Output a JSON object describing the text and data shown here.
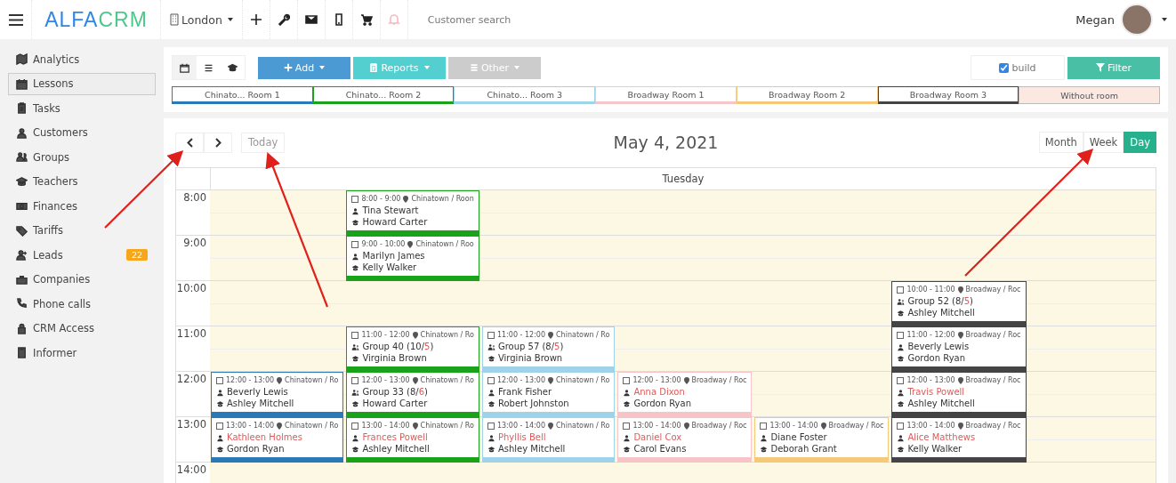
{
  "topbar": {
    "logo": {
      "first": "ALFA",
      "second": "CRM"
    },
    "city": "London",
    "icons": [
      {
        "disabled": false
      },
      {
        "disabled": false
      },
      {
        "disabled": false
      },
      {
        "disabled": false
      },
      {
        "disabled": false
      },
      {
        "disabled": true
      }
    ],
    "search": {
      "placeholder": "Customer search"
    },
    "user": "Megan"
  },
  "sidebar": {
    "items": [
      {
        "label": "Analytics",
        "selected": false
      },
      {
        "label": "Lessons",
        "selected": true
      },
      {
        "label": "Tasks",
        "selected": false
      },
      {
        "label": "Customers",
        "selected": false
      },
      {
        "label": "Groups",
        "selected": false
      },
      {
        "label": "Teachers",
        "selected": false
      },
      {
        "label": "Finances",
        "selected": false
      },
      {
        "label": "Tariffs",
        "selected": false
      },
      {
        "label": "Leads",
        "selected": false,
        "badge": "22"
      },
      {
        "label": "Companies",
        "selected": false
      },
      {
        "label": "Phone calls",
        "selected": false
      },
      {
        "label": "CRM Access",
        "selected": false
      },
      {
        "label": "Informer",
        "selected": false
      }
    ]
  },
  "toolbar": {
    "views": [
      {
        "selected": true
      },
      {
        "selected": false
      },
      {
        "selected": false
      }
    ],
    "actions": [
      {
        "label": "Add",
        "disabled": false
      },
      {
        "label": "Reports",
        "disabled": false
      },
      {
        "label": "Other",
        "disabled": true
      }
    ],
    "build": {
      "label": "build",
      "checked": true
    },
    "filter": "Filter"
  },
  "rooms": [
    {
      "label": "Chinato... Room 1",
      "color": "#2a7ab9",
      "kind": "room"
    },
    {
      "label": "Chinato... Room 2",
      "color": "#1aa31a",
      "kind": "room"
    },
    {
      "label": "Chinato... Room 3",
      "color": "#9fd3ea",
      "kind": "room"
    },
    {
      "label": "Broadway Room 1",
      "color": "#f7c4c8",
      "kind": "room"
    },
    {
      "label": "Broadway Room 2",
      "color": "#f5c97a",
      "kind": "room"
    },
    {
      "label": "Broadway Room 3",
      "color": "#444444",
      "kind": "room"
    },
    {
      "label": "Without room",
      "color": "#fbe8e1",
      "kind": "none"
    }
  ],
  "calendar": {
    "title": "May 4, 2021",
    "today": "Today",
    "views": [
      {
        "label": "Month",
        "selected": false
      },
      {
        "label": "Week",
        "selected": false
      },
      {
        "label": "Day",
        "selected": true
      }
    ],
    "day": "Tuesday",
    "rows": [
      {
        "time": "8:00",
        "cells": [
          null,
          {
            "time": "8:00 - 9:00",
            "place": "Chinatown / Roon",
            "kind": "single",
            "name": "Tina Stewart",
            "overdue": false,
            "teacher": "Howard Carter"
          },
          null,
          null,
          null,
          null,
          null
        ]
      },
      {
        "time": "9:00",
        "cells": [
          null,
          {
            "time": "9:00 - 10:00",
            "place": "Chinatown / Roo",
            "kind": "single",
            "name": "Marilyn James",
            "overdue": false,
            "teacher": "Kelly Walker"
          },
          null,
          null,
          null,
          null,
          null
        ]
      },
      {
        "time": "10:00",
        "cells": [
          null,
          null,
          null,
          null,
          null,
          {
            "time": "10:00 - 11:00",
            "place": "Broadway / Roc",
            "kind": "group",
            "name": "Group 52",
            "count_parts": [
              {
                "text": "(8/",
                "alert": false
              },
              {
                "text": "5",
                "alert": true
              },
              {
                "text": ")",
                "alert": false
              }
            ],
            "teacher": "Ashley Mitchell"
          },
          null
        ]
      },
      {
        "time": "11:00",
        "cells": [
          null,
          {
            "time": "11:00 - 12:00",
            "place": "Chinatown / Ro",
            "kind": "group",
            "name": "Group 40",
            "count_parts": [
              {
                "text": "(10/",
                "alert": false
              },
              {
                "text": "5",
                "alert": true
              },
              {
                "text": ")",
                "alert": false
              }
            ],
            "teacher": "Virginia Brown"
          },
          {
            "time": "11:00 - 12:00",
            "place": "Chinatown / Ro",
            "kind": "group",
            "name": "Group 57",
            "count_parts": [
              {
                "text": "(8/",
                "alert": false
              },
              {
                "text": "5",
                "alert": true
              },
              {
                "text": ")",
                "alert": false
              }
            ],
            "teacher": "Virginia Brown"
          },
          null,
          null,
          {
            "time": "11:00 - 12:00",
            "place": "Broadway / Roc",
            "kind": "single",
            "name": "Beverly Lewis",
            "overdue": false,
            "teacher": "Gordon Ryan"
          },
          null
        ]
      },
      {
        "time": "12:00",
        "cells": [
          {
            "time": "12:00 - 13:00",
            "place": "Chinatown / Ro",
            "kind": "single",
            "name": "Beverly Lewis",
            "overdue": false,
            "teacher": "Ashley Mitchell"
          },
          {
            "time": "12:00 - 13:00",
            "place": "Chinatown / Ro",
            "kind": "group",
            "name": "Group 33",
            "count_parts": [
              {
                "text": "(8/",
                "alert": false
              },
              {
                "text": "6",
                "alert": true
              },
              {
                "text": ")",
                "alert": false
              }
            ],
            "teacher": "Howard Carter"
          },
          {
            "time": "12:00 - 13:00",
            "place": "Chinatown / Ro",
            "kind": "single",
            "name": "Frank Fisher",
            "overdue": false,
            "teacher": "Robert Johnston"
          },
          {
            "time": "12:00 - 13:00",
            "place": "Broadway / Roc",
            "kind": "single",
            "name": "Anna Dixon",
            "overdue": true,
            "teacher": "Gordon Ryan"
          },
          null,
          {
            "time": "12:00 - 13:00",
            "place": "Broadway / Roc",
            "kind": "single",
            "name": "Travis Powell",
            "overdue": true,
            "teacher": "Ashley Mitchell"
          },
          null
        ]
      },
      {
        "time": "13:00",
        "cells": [
          {
            "time": "13:00 - 14:00",
            "place": "Chinatown / Ro",
            "kind": "single",
            "name": "Kathleen Holmes",
            "overdue": true,
            "teacher": "Gordon Ryan"
          },
          {
            "time": "13:00 - 14:00",
            "place": "Chinatown / Ro",
            "kind": "single",
            "name": "Frances Powell",
            "overdue": true,
            "teacher": "Ashley Mitchell"
          },
          {
            "time": "13:00 - 14:00",
            "place": "Chinatown / Ro",
            "kind": "single",
            "name": "Phyllis Bell",
            "overdue": true,
            "teacher": "Ashley Mitchell"
          },
          {
            "time": "13:00 - 14:00",
            "place": "Broadway / Roc",
            "kind": "single",
            "name": "Daniel Cox",
            "overdue": true,
            "teacher": "Carol Evans"
          },
          {
            "time": "13:00 - 14:00",
            "place": "Broadway / Roc",
            "kind": "single",
            "name": "Diane Foster",
            "overdue": false,
            "teacher": "Deborah Grant"
          },
          {
            "time": "13:00 - 14:00",
            "place": "Broadway / Roc",
            "kind": "single",
            "name": "Alice Matthews",
            "overdue": true,
            "teacher": "Kelly Walker"
          },
          null
        ]
      },
      {
        "time": "14:00",
        "cells": [
          null,
          null,
          null,
          null,
          null,
          null,
          null
        ]
      }
    ]
  }
}
